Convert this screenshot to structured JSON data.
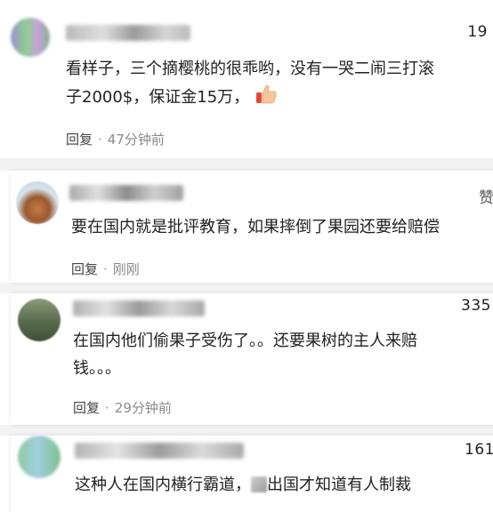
{
  "comments": [
    {
      "likes": "19",
      "text_line1": "看样子，三个摘樱桃的很乖哟，没有一哭二闹三打滚",
      "text_line2": "子2000$，保证金15万，",
      "reply_label": "回复",
      "separator": "·",
      "time": "47分钟前",
      "emoji_icon": "thumbs-up-icon"
    },
    {
      "likes": "赞",
      "text_line1": "要在国内就是批评教育，如果摔倒了果园还要给赔偿",
      "reply_label": "回复",
      "separator": "·",
      "time": "刚刚"
    },
    {
      "likes": "335",
      "text_line1": "在国内他们偷果子受伤了。。还要果树的主人来赔",
      "text_line2": "钱。。。",
      "reply_label": "回复",
      "separator": "·",
      "time": "29分钟前"
    },
    {
      "likes": "161",
      "text_before": "这种人在国内横行霸道，",
      "text_after": "出国才知道有人制裁"
    }
  ],
  "colors": {
    "text": "#222222",
    "time": "#8a8a8a",
    "reply": "#444444",
    "background": "#ffffff",
    "divider": "#f3f3f3"
  }
}
